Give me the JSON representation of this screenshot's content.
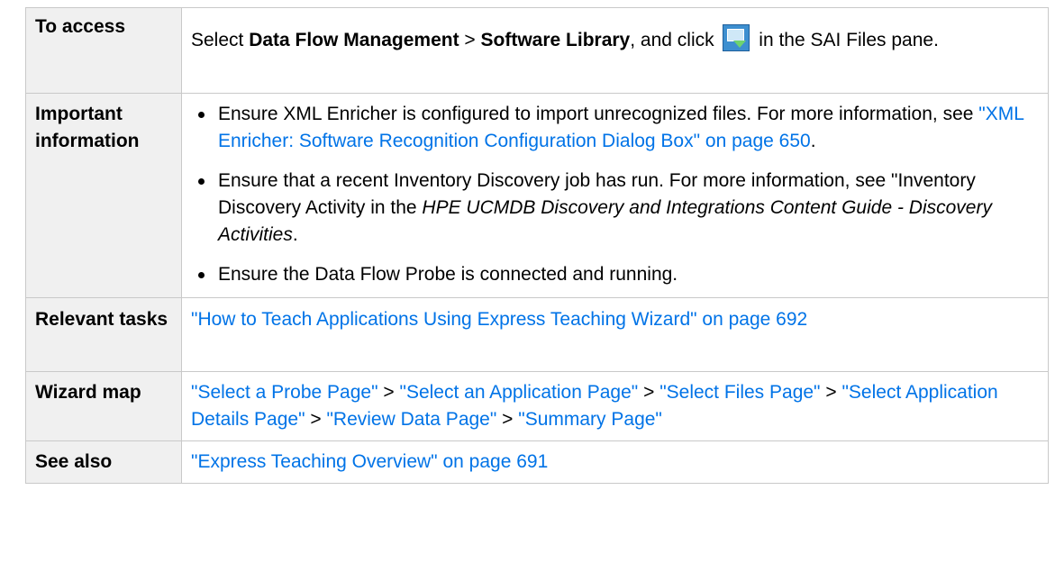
{
  "rows": {
    "access": {
      "label": "To access",
      "t1": "Select ",
      "b1": "Data Flow Management",
      "t2": " > ",
      "b2": "Software Library",
      "t3": ", and click ",
      "icon": "add-files-icon",
      "t4": " in the SAI Files pane."
    },
    "important": {
      "label": "Important information",
      "bullet1": {
        "t1": "Ensure XML Enricher is configured to import unrecognized files. For more information, see ",
        "link": "\"XML Enricher: Software Recognition Configuration Dialog Box\" on page 650",
        "t2": "."
      },
      "bullet2": {
        "t1": "Ensure that a recent Inventory Discovery job has run. For more information, see \"Inventory Discovery Activity in the ",
        "i1": "HPE UCMDB Discovery and Integrations Content Guide - Discovery Activities",
        "t2": "."
      },
      "bullet3": "Ensure the Data Flow Probe is connected and running."
    },
    "tasks": {
      "label": "Relevant tasks",
      "link": "\"How to Teach Applications Using Express Teaching Wizard\" on page 692"
    },
    "wizard": {
      "label": "Wizard map",
      "sep": " > ",
      "pages": [
        "\"Select a Probe Page\"",
        "\"Select an Application Page\"",
        "\"Select Files Page\"",
        "\"Select Application Details Page\"",
        "\"Review Data Page\"",
        "\"Summary Page\""
      ]
    },
    "see_also": {
      "label": "See also",
      "link": "\"Express Teaching Overview\" on page 691"
    }
  },
  "colors": {
    "link": "#0073e7",
    "label_bg": "#f0f0f0",
    "border": "#c9c9c9"
  }
}
